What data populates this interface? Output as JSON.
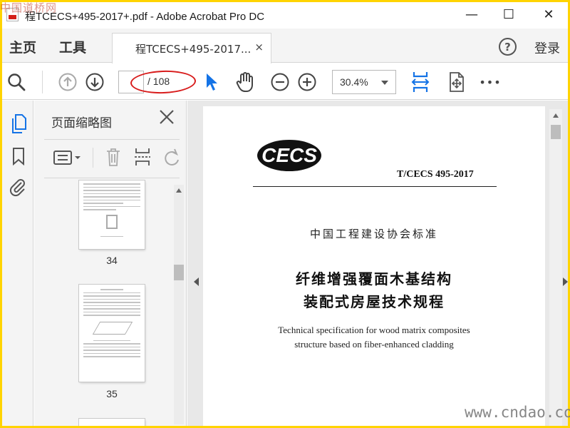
{
  "watermark_top": "中国道桥网",
  "watermark_bottom": "www.cndao.com",
  "window": {
    "title": "程TCECS+495-2017+.pdf - Adobe Acrobat Pro DC",
    "minimize": "—",
    "maximize": "☐",
    "close": "✕"
  },
  "menubar": {
    "home": "主页",
    "tools": "工具",
    "doc_tab": "程TCECS+495-2017...",
    "doc_tab_close": "×",
    "help": "?",
    "login": "登录"
  },
  "toolbar": {
    "current_page": "",
    "page_total": "/ 108",
    "zoom": "30.4%",
    "more": "•••"
  },
  "thumbnail_panel": {
    "title": "页面缩略图",
    "pages": [
      {
        "number": "34"
      },
      {
        "number": "35"
      }
    ]
  },
  "document": {
    "logo_text": "CECS",
    "std_code": "T/CECS 495-2017",
    "association": "中国工程建设协会标准",
    "title_cn_line1": "纤维增强覆面木基结构",
    "title_cn_line2": "装配式房屋技术规程",
    "title_en_line1": "Technical specification for wood matrix composites",
    "title_en_line2": "structure based on fiber-enhanced cladding"
  },
  "colors": {
    "accent_blue": "#1473e6",
    "annotation_red": "#d81c1c",
    "panel_bg": "#f4f4f4",
    "doc_bg": "#e8e8e8"
  }
}
